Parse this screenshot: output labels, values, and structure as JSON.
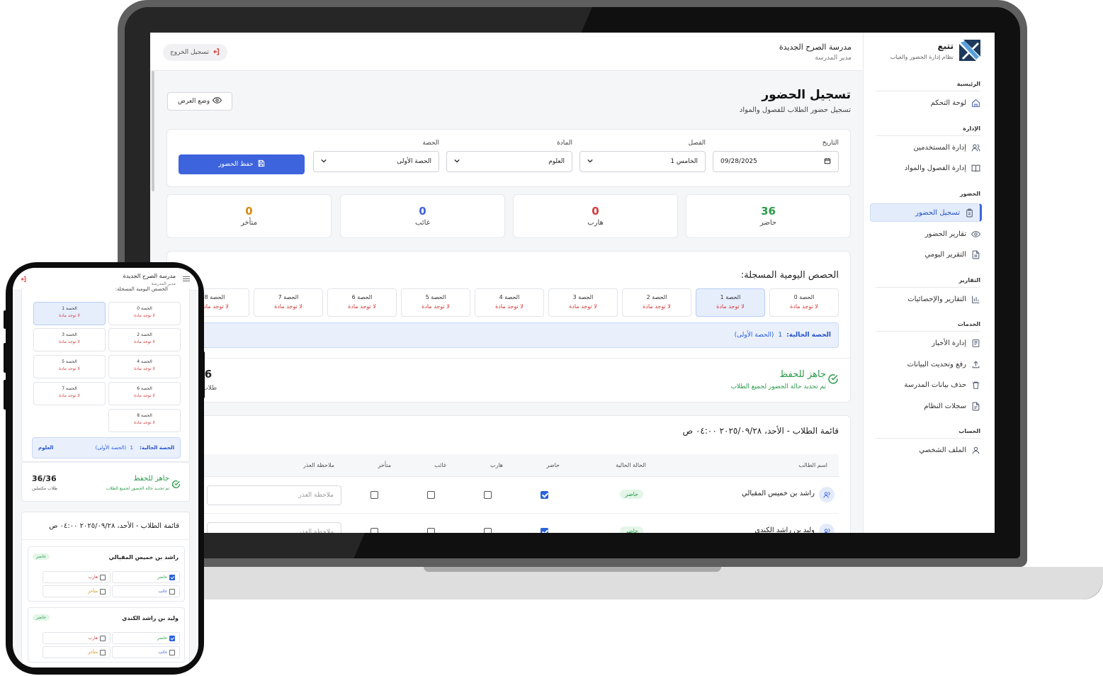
{
  "app": {
    "brand_title": "تتبع",
    "brand_subtitle": "نظام إدارة الحضور والغياب",
    "school_name": "مدرسة الصرح الجديدة",
    "school_role": "مدير المدرسة",
    "logout_label": "تسجيل الخروج"
  },
  "sidebar": {
    "sections": [
      {
        "title": "الرئيسية",
        "items": [
          {
            "label": "لوحة التحكم",
            "icon": "home-icon"
          }
        ]
      },
      {
        "title": "الإدارة",
        "items": [
          {
            "label": "إدارة المستخدمين",
            "icon": "users-icon"
          },
          {
            "label": "إدارة الفصول والمواد",
            "icon": "book-icon"
          }
        ]
      },
      {
        "title": "الحضور",
        "items": [
          {
            "label": "تسجيل الحضور",
            "icon": "clipboard-icon",
            "active": true
          },
          {
            "label": "تقارير الحضور",
            "icon": "eye-icon"
          },
          {
            "label": "التقرير اليومي",
            "icon": "file-icon"
          }
        ]
      },
      {
        "title": "التقارير",
        "items": [
          {
            "label": "التقارير والإحصائيات",
            "icon": "bar-chart-icon"
          }
        ]
      },
      {
        "title": "الخدمات",
        "items": [
          {
            "label": "إدارة الأخبار",
            "icon": "news-icon"
          },
          {
            "label": "رفع وتحديث البيانات",
            "icon": "upload-icon"
          },
          {
            "label": "حذف بيانات المدرسة",
            "icon": "trash-icon"
          },
          {
            "label": "سجلات النظام",
            "icon": "log-icon"
          }
        ]
      },
      {
        "title": "الحساب",
        "items": [
          {
            "label": "الملف الشخصي",
            "icon": "user-icon"
          }
        ]
      }
    ]
  },
  "page": {
    "title": "تسجيل الحضور",
    "subtitle": "تسجيل حضور الطلاب للفصول والمواد",
    "view_mode_label": "وضع العرض"
  },
  "filters": {
    "date_label": "التاريخ",
    "date_value": "09/28/2025",
    "class_label": "الفصل",
    "class_value": "الخامس 1",
    "subject_label": "المادة",
    "subject_value": "العلوم",
    "period_label": "الحصة",
    "period_value": "الحصة الأولى",
    "save_label": "حفظ الحضور"
  },
  "stats": [
    {
      "value": "36",
      "label": "حاضر",
      "color": "#2a9a48"
    },
    {
      "value": "0",
      "label": "هارب",
      "color": "#d43a3a"
    },
    {
      "value": "0",
      "label": "غائب",
      "color": "#3d63dd"
    },
    {
      "value": "0",
      "label": "متأخر",
      "color": "#d98a10"
    }
  ],
  "periods": {
    "title": "الحصص اليومية المسجلة:",
    "mobile_cut_title": "الحصص اليومية المسجلة:",
    "no_subject": "لا توجد مادة",
    "items": [
      {
        "label": "الحصة 0"
      },
      {
        "label": "الحصة 1",
        "selected": true
      },
      {
        "label": "الحصة 2"
      },
      {
        "label": "الحصة 3"
      },
      {
        "label": "الحصة 4"
      },
      {
        "label": "الحصة 5"
      },
      {
        "label": "الحصة 6"
      },
      {
        "label": "الحصة 7"
      },
      {
        "label": "الحصة 8"
      }
    ],
    "current_key": "الحصة الحالية:",
    "current_num": "1",
    "current_name": "(الحصة الأولى)",
    "current_subject": "العلوم",
    "current_subject_cut": "ال"
  },
  "ready": {
    "title": "جاهز للحفظ",
    "subtitle": "تم تحديد حالة الحضور لجميع الطلاب",
    "count": "36/36",
    "count_cut": "/36",
    "count_label": "طلاب مكتملين",
    "count_label_cut": "طلاب"
  },
  "students": {
    "title": "قائمة الطلاب - الأحد، ٢٠٢٥/٠٩/٢٨ ٠٤:٠٠ ص",
    "headers": {
      "name": "اسم الطالب",
      "status": "الحالة الحالية",
      "present": "حاضر",
      "escaped": "هارب",
      "absent": "غائب",
      "late": "متأخر",
      "note": "ملاحظة العذر"
    },
    "note_placeholder": "ملاحظة العذر",
    "rows": [
      {
        "name": "راشد بن خميس المقبالي",
        "status": "حاضر"
      },
      {
        "name": "وليد بن راشد الكندي",
        "status": "حاضر"
      }
    ]
  }
}
